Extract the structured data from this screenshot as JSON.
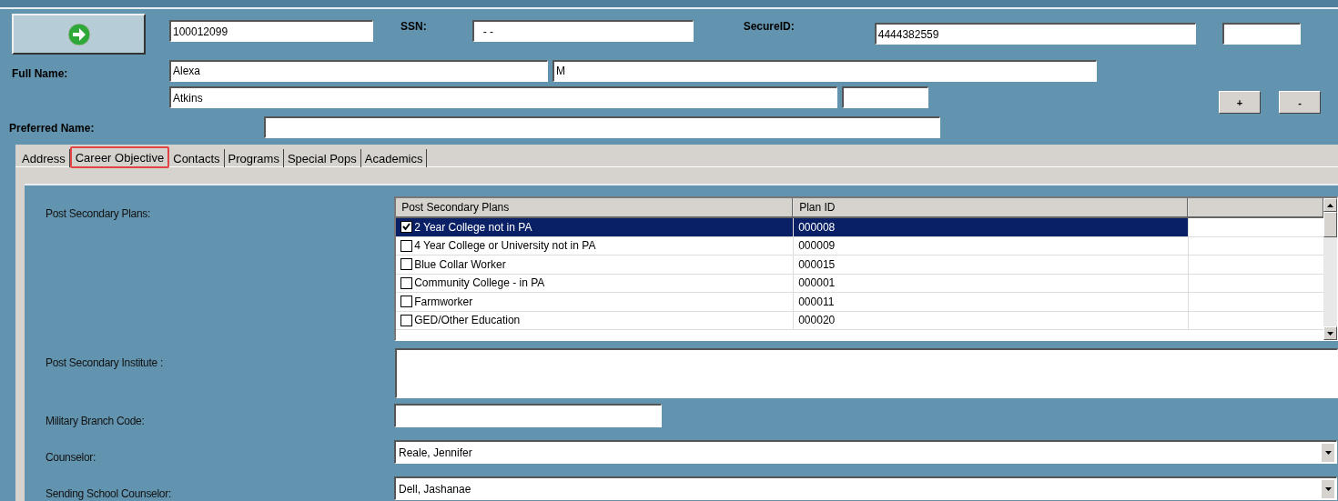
{
  "header": {
    "id_number": "100012099",
    "ssn_label": "SSN:",
    "ssn": "- -",
    "secure_id_label": "SecureID:",
    "secure_id": "4444382559",
    "full_name_label": "Full Name:",
    "first_name": "Alexa",
    "middle_name": "M",
    "last_name": "Atkins",
    "preferred_name_label": "Preferred Name:",
    "add_button": "+",
    "remove_button": "-"
  },
  "tabs": [
    {
      "label": "Address",
      "selected": false
    },
    {
      "label": "Career Objective",
      "selected": true
    },
    {
      "label": "Contacts",
      "selected": false
    },
    {
      "label": "Programs",
      "selected": false
    },
    {
      "label": "Special Pops",
      "selected": false
    },
    {
      "label": "Academics",
      "selected": false
    }
  ],
  "post_secondary_plans": {
    "label": "Post Secondary Plans:",
    "columns": [
      "Post Secondary Plans",
      "Plan ID"
    ],
    "rows": [
      {
        "plan": "2 Year College not in PA",
        "plan_id": "000008",
        "checked": true,
        "selected": true
      },
      {
        "plan": "4 Year College or University not in PA",
        "plan_id": "000009",
        "checked": false,
        "selected": false
      },
      {
        "plan": "Blue Collar Worker",
        "plan_id": "000015",
        "checked": false,
        "selected": false
      },
      {
        "plan": "Community College - in PA",
        "plan_id": "000001",
        "checked": false,
        "selected": false
      },
      {
        "plan": "Farmworker",
        "plan_id": "000011",
        "checked": false,
        "selected": false
      },
      {
        "plan": "GED/Other Education",
        "plan_id": "000020",
        "checked": false,
        "selected": false
      }
    ]
  },
  "post_secondary_institute": {
    "label": "Post Secondary Institute :"
  },
  "military_branch_code": {
    "label": "Military Branch Code:"
  },
  "counselor": {
    "label": "Counselor:",
    "value": "Reale, Jennifer"
  },
  "sending_school_counselor": {
    "label": "Sending School Counselor:",
    "value": "Dell, Jashanae"
  }
}
